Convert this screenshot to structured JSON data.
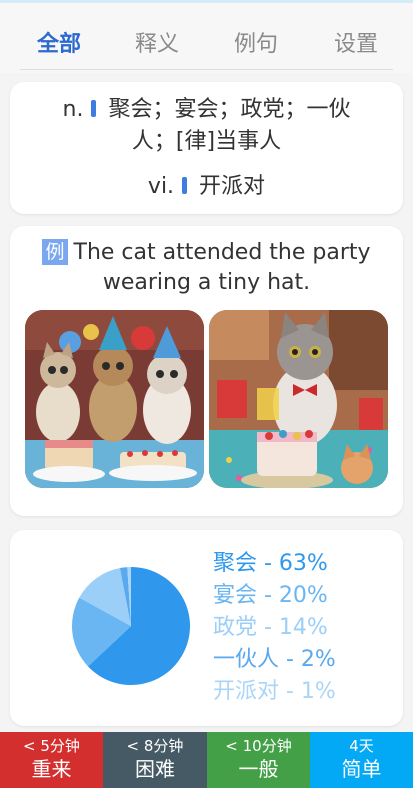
{
  "colors": {
    "accent": "#2d6ad0",
    "pie_main": "#2f98ec",
    "again": "#d32f2f",
    "hard": "#455a64",
    "good": "#43a047",
    "easy": "#03a9f4"
  },
  "tabs": [
    {
      "label": "全部",
      "active": true
    },
    {
      "label": "释义",
      "active": false
    },
    {
      "label": "例句",
      "active": false
    },
    {
      "label": "设置",
      "active": false
    }
  ],
  "definitions": {
    "row1_pos": "n.",
    "row1_meaning_line1": "聚会；宴会；政党；一伙",
    "row1_meaning_line2": "人；[律]当事人",
    "row2_pos": "vi.",
    "row2_meaning": "开派对"
  },
  "example": {
    "badge": "例",
    "sentence": "The cat attended the party wearing a tiny hat.",
    "images": [
      {
        "alt": "group of cats wearing party hats with cakes"
      },
      {
        "alt": "cat with bow tie and birthday cake"
      }
    ]
  },
  "chart_data": {
    "type": "pie",
    "slices": [
      {
        "label": "聚会 - 63%",
        "name": "聚会",
        "value": 63,
        "color": "#2f98ec"
      },
      {
        "label": "宴会 - 20%",
        "name": "宴会",
        "value": 20,
        "color": "#69b6f3"
      },
      {
        "label": "政党 - 14%",
        "name": "政党",
        "value": 14,
        "color": "#9ccff8"
      },
      {
        "label": "一伙人 - 2%",
        "name": "一伙人",
        "value": 2,
        "color": "#5aa9ee"
      },
      {
        "label": "开派对 - 1%",
        "name": "开派对",
        "value": 1,
        "color": "#a9d5f8"
      }
    ],
    "legend": "right"
  },
  "footer": [
    {
      "time": "< 5分钟",
      "label": "重来",
      "color": "#d32f2f"
    },
    {
      "time": "< 8分钟",
      "label": "困难",
      "color": "#455a64"
    },
    {
      "time": "< 10分钟",
      "label": "一般",
      "color": "#43a047"
    },
    {
      "time": "4天",
      "label": "简单",
      "color": "#03a9f4"
    }
  ]
}
